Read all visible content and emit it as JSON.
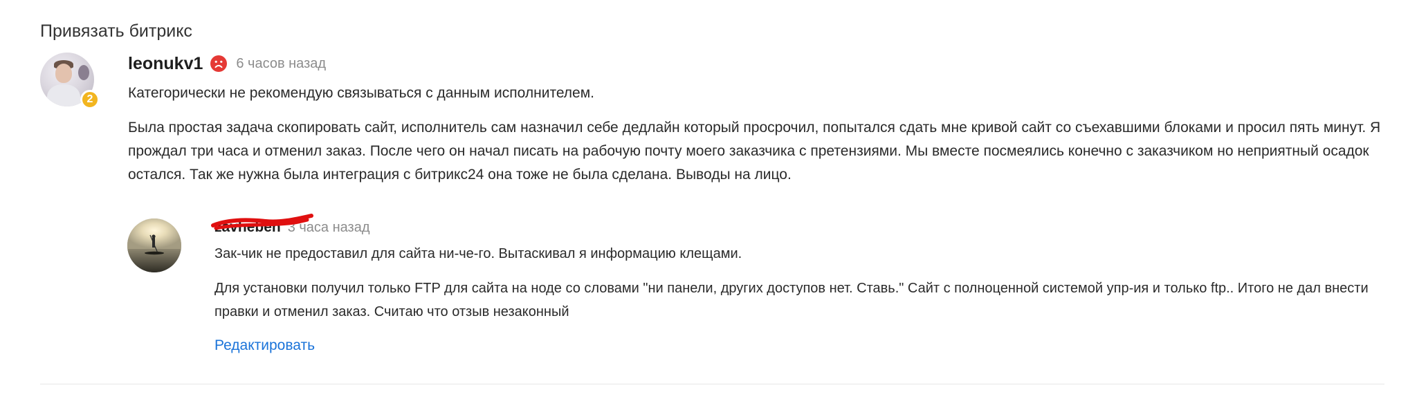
{
  "section": {
    "title": "Привязать битрикс"
  },
  "review": {
    "username": "leonukv1",
    "rating_badge": "2",
    "sentiment_icon": "sad-face-icon",
    "sentiment_color": "#e53935",
    "time": "6 часов назад",
    "paragraphs": [
      "Категорически не рекомендую связываться с данным исполнителем.",
      "Была простая задача скопировать сайт, исполнитель сам назначил себе дедлайн который просрочил, попытался сдать мне кривой сайт со съехавшими блоками и просил пять минут. Я прождал три часа и отменил заказ. После чего он начал писать на рабочую почту моего заказчика с претензиями. Мы вместе посмеялись конечно с заказчиком но неприятный осадок остался. Так же нужна была интеграция с битрикс24 она тоже не была сделана. Выводы на лицо."
    ]
  },
  "reply": {
    "username": "zavheben",
    "time": "3 часа назад",
    "paragraphs": [
      "Зак-чик не предоставил для сайта ни-че-го. Вытаскивал я информацию клещами.",
      "Для установки получил только FTP для сайта на ноде со словами \"ни панели, других доступов нет. Ставь.\" Сайт с полноценной системой упр-ия и только ftp..  Итого не дал внести правки и отменил заказ. Считаю что отзыв незаконный"
    ],
    "edit_label": "Редактировать"
  },
  "colors": {
    "link": "#1a73d9",
    "badge": "#f2b51f",
    "scribble": "#e01010"
  }
}
